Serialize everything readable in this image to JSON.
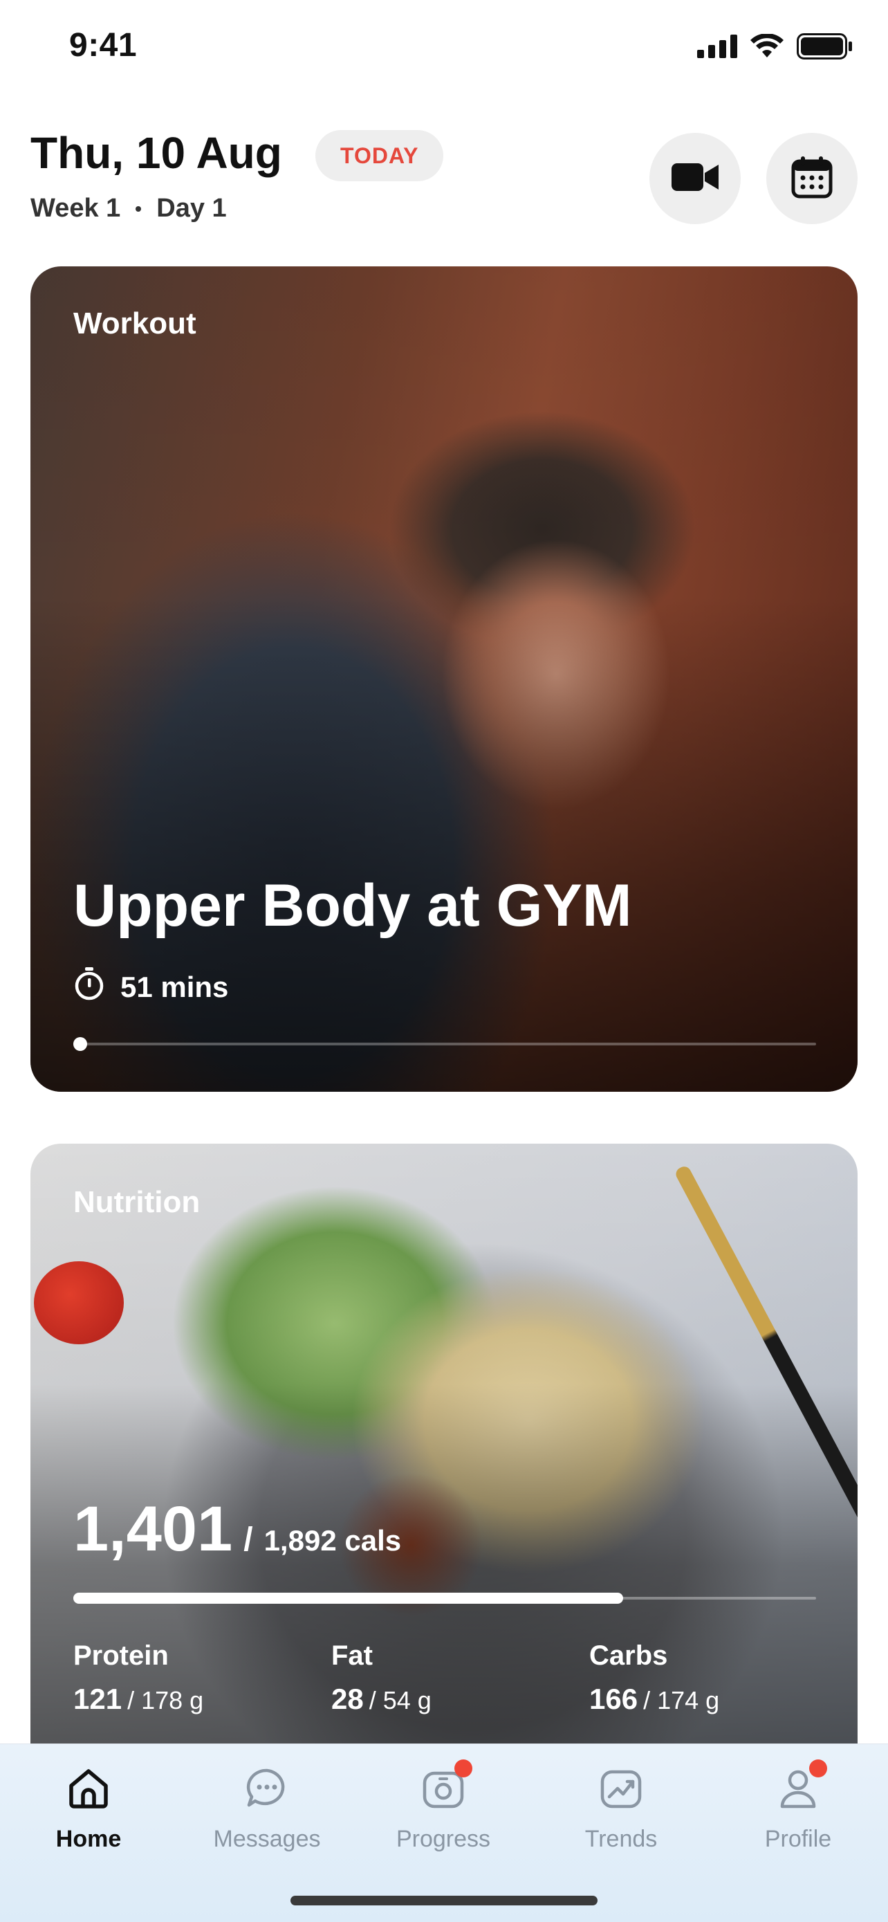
{
  "status_bar": {
    "time": "9:41"
  },
  "header": {
    "date": "Thu, 10 Aug",
    "today_badge": "TODAY",
    "week": "Week 1",
    "day": "Day 1",
    "icons": [
      "video-camera-icon",
      "calendar-icon"
    ]
  },
  "workout": {
    "label": "Workout",
    "title": "Upper Body at GYM",
    "duration": "51 mins",
    "progress_fraction": 0.0
  },
  "nutrition": {
    "label": "Nutrition",
    "calories_value": "1,401",
    "slash": "/",
    "calories_target": "1,892 cals",
    "progress_fraction": 0.74,
    "macros": [
      {
        "name": "Protein",
        "current": "121",
        "rest": "/ 178 g"
      },
      {
        "name": "Fat",
        "current": "28",
        "rest": "/ 54 g"
      },
      {
        "name": "Carbs",
        "current": "166",
        "rest": "/ 174 g"
      }
    ]
  },
  "tabs": [
    {
      "label": "Home",
      "icon": "home-icon",
      "active": true,
      "badge": false
    },
    {
      "label": "Messages",
      "icon": "messages-icon",
      "active": false,
      "badge": false
    },
    {
      "label": "Progress",
      "icon": "progress-camera-icon",
      "active": false,
      "badge": true
    },
    {
      "label": "Trends",
      "icon": "trends-icon",
      "active": false,
      "badge": false
    },
    {
      "label": "Profile",
      "icon": "profile-icon",
      "active": false,
      "badge": true
    }
  ],
  "colors": {
    "accent_red": "#e5483c",
    "badge_red": "#ef4636",
    "inactive_tab": "#8a96a3"
  }
}
